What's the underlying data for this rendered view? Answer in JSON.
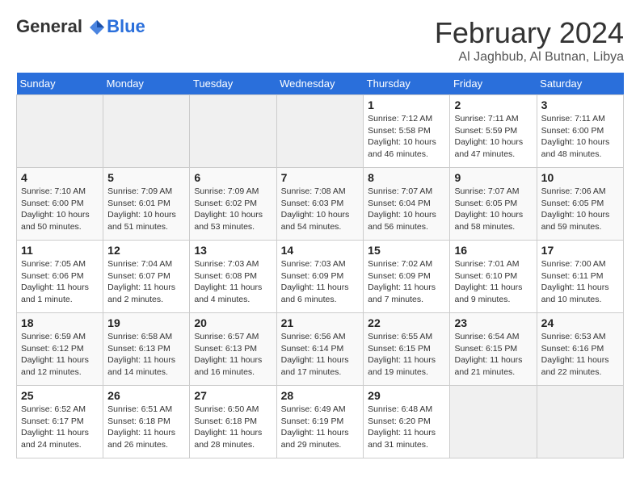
{
  "header": {
    "logo": {
      "general": "General",
      "blue": "Blue",
      "tagline": ""
    },
    "title": "February 2024",
    "location": "Al Jaghbub, Al Butnan, Libya"
  },
  "weekdays": [
    "Sunday",
    "Monday",
    "Tuesday",
    "Wednesday",
    "Thursday",
    "Friday",
    "Saturday"
  ],
  "weeks": [
    [
      {
        "day": "",
        "empty": true
      },
      {
        "day": "",
        "empty": true
      },
      {
        "day": "",
        "empty": true
      },
      {
        "day": "",
        "empty": true
      },
      {
        "day": "1",
        "sunrise": "7:12 AM",
        "sunset": "5:58 PM",
        "daylight": "10 hours and 46 minutes."
      },
      {
        "day": "2",
        "sunrise": "7:11 AM",
        "sunset": "5:59 PM",
        "daylight": "10 hours and 47 minutes."
      },
      {
        "day": "3",
        "sunrise": "7:11 AM",
        "sunset": "6:00 PM",
        "daylight": "10 hours and 48 minutes."
      }
    ],
    [
      {
        "day": "4",
        "sunrise": "7:10 AM",
        "sunset": "6:00 PM",
        "daylight": "10 hours and 50 minutes."
      },
      {
        "day": "5",
        "sunrise": "7:09 AM",
        "sunset": "6:01 PM",
        "daylight": "10 hours and 51 minutes."
      },
      {
        "day": "6",
        "sunrise": "7:09 AM",
        "sunset": "6:02 PM",
        "daylight": "10 hours and 53 minutes."
      },
      {
        "day": "7",
        "sunrise": "7:08 AM",
        "sunset": "6:03 PM",
        "daylight": "10 hours and 54 minutes."
      },
      {
        "day": "8",
        "sunrise": "7:07 AM",
        "sunset": "6:04 PM",
        "daylight": "10 hours and 56 minutes."
      },
      {
        "day": "9",
        "sunrise": "7:07 AM",
        "sunset": "6:05 PM",
        "daylight": "10 hours and 58 minutes."
      },
      {
        "day": "10",
        "sunrise": "7:06 AM",
        "sunset": "6:05 PM",
        "daylight": "10 hours and 59 minutes."
      }
    ],
    [
      {
        "day": "11",
        "sunrise": "7:05 AM",
        "sunset": "6:06 PM",
        "daylight": "11 hours and 1 minute."
      },
      {
        "day": "12",
        "sunrise": "7:04 AM",
        "sunset": "6:07 PM",
        "daylight": "11 hours and 2 minutes."
      },
      {
        "day": "13",
        "sunrise": "7:03 AM",
        "sunset": "6:08 PM",
        "daylight": "11 hours and 4 minutes."
      },
      {
        "day": "14",
        "sunrise": "7:03 AM",
        "sunset": "6:09 PM",
        "daylight": "11 hours and 6 minutes."
      },
      {
        "day": "15",
        "sunrise": "7:02 AM",
        "sunset": "6:09 PM",
        "daylight": "11 hours and 7 minutes."
      },
      {
        "day": "16",
        "sunrise": "7:01 AM",
        "sunset": "6:10 PM",
        "daylight": "11 hours and 9 minutes."
      },
      {
        "day": "17",
        "sunrise": "7:00 AM",
        "sunset": "6:11 PM",
        "daylight": "11 hours and 10 minutes."
      }
    ],
    [
      {
        "day": "18",
        "sunrise": "6:59 AM",
        "sunset": "6:12 PM",
        "daylight": "11 hours and 12 minutes."
      },
      {
        "day": "19",
        "sunrise": "6:58 AM",
        "sunset": "6:13 PM",
        "daylight": "11 hours and 14 minutes."
      },
      {
        "day": "20",
        "sunrise": "6:57 AM",
        "sunset": "6:13 PM",
        "daylight": "11 hours and 16 minutes."
      },
      {
        "day": "21",
        "sunrise": "6:56 AM",
        "sunset": "6:14 PM",
        "daylight": "11 hours and 17 minutes."
      },
      {
        "day": "22",
        "sunrise": "6:55 AM",
        "sunset": "6:15 PM",
        "daylight": "11 hours and 19 minutes."
      },
      {
        "day": "23",
        "sunrise": "6:54 AM",
        "sunset": "6:15 PM",
        "daylight": "11 hours and 21 minutes."
      },
      {
        "day": "24",
        "sunrise": "6:53 AM",
        "sunset": "6:16 PM",
        "daylight": "11 hours and 22 minutes."
      }
    ],
    [
      {
        "day": "25",
        "sunrise": "6:52 AM",
        "sunset": "6:17 PM",
        "daylight": "11 hours and 24 minutes."
      },
      {
        "day": "26",
        "sunrise": "6:51 AM",
        "sunset": "6:18 PM",
        "daylight": "11 hours and 26 minutes."
      },
      {
        "day": "27",
        "sunrise": "6:50 AM",
        "sunset": "6:18 PM",
        "daylight": "11 hours and 28 minutes."
      },
      {
        "day": "28",
        "sunrise": "6:49 AM",
        "sunset": "6:19 PM",
        "daylight": "11 hours and 29 minutes."
      },
      {
        "day": "29",
        "sunrise": "6:48 AM",
        "sunset": "6:20 PM",
        "daylight": "11 hours and 31 minutes."
      },
      {
        "day": "",
        "empty": true
      },
      {
        "day": "",
        "empty": true
      }
    ]
  ]
}
